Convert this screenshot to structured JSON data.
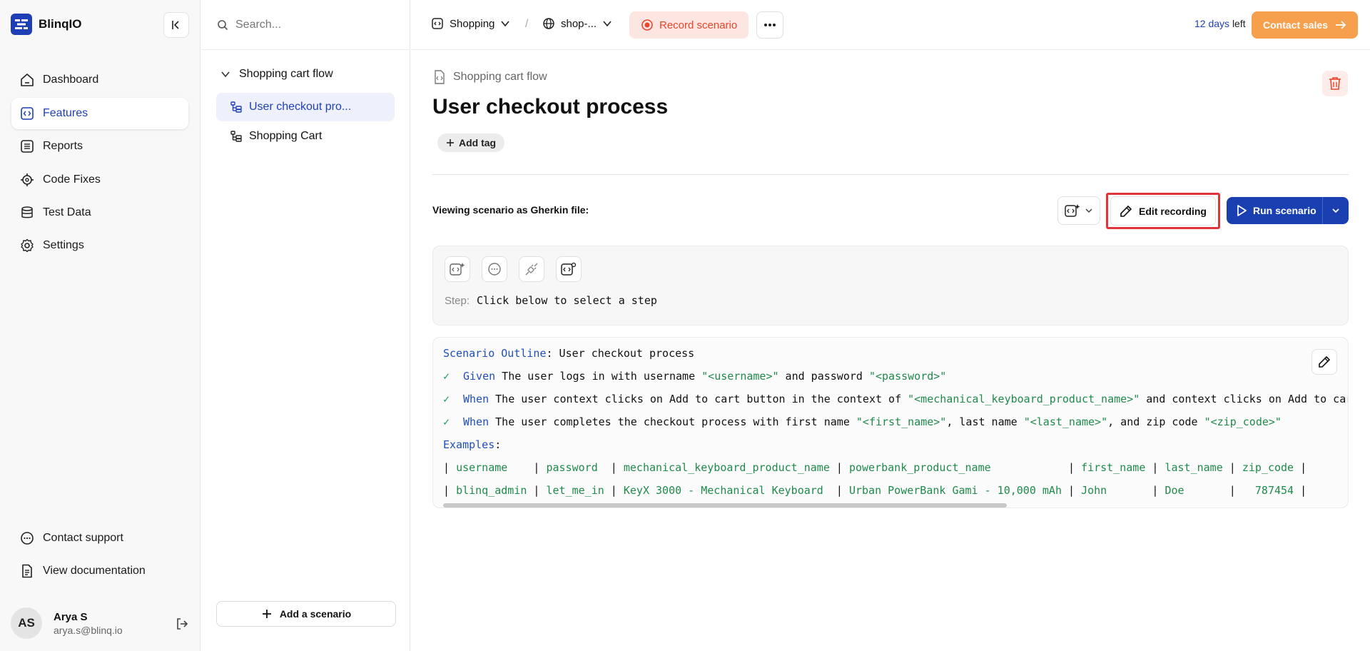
{
  "app": {
    "name": "BlinqIO",
    "colors": {
      "brand": "#1f3fb6",
      "accent": "#f6a04d",
      "record": "#e8452c",
      "success": "#1aa05a"
    }
  },
  "sidebar": {
    "nav": [
      {
        "label": "Dashboard",
        "icon": "home-icon"
      },
      {
        "label": "Features",
        "icon": "feature-file-icon",
        "active": true
      },
      {
        "label": "Reports",
        "icon": "report-list-icon"
      },
      {
        "label": "Code Fixes",
        "icon": "code-gear-icon"
      },
      {
        "label": "Test Data",
        "icon": "database-icon"
      },
      {
        "label": "Settings",
        "icon": "gear-icon"
      }
    ],
    "bottom": [
      {
        "label": "Contact support",
        "icon": "chat-bubble-icon"
      },
      {
        "label": "View documentation",
        "icon": "document-icon"
      }
    ],
    "user": {
      "initials": "AS",
      "name": "Arya S",
      "email": "arya.s@blinq.io"
    }
  },
  "tree": {
    "search_placeholder": "Search...",
    "feature": "Shopping cart flow",
    "items": [
      {
        "label": "User checkout pro...",
        "selected": true
      },
      {
        "label": "Shopping Cart",
        "selected": false
      }
    ],
    "add_scenario": "Add a scenario"
  },
  "topbar": {
    "project": "Shopping",
    "separator": "/",
    "environment": "shop-...",
    "record": "Record scenario",
    "trial_days": "12 days",
    "trial_suffix": "left",
    "contact_sales": "Contact sales"
  },
  "main": {
    "breadcrumb": "Shopping cart flow",
    "title": "User checkout process",
    "add_tag": "Add tag",
    "viewing_label": "Viewing scenario as Gherkin file:",
    "edit_recording": "Edit recording",
    "run_scenario": "Run scenario",
    "step_label": "Step:",
    "step_value": "Click below to select a step"
  },
  "gherkin": {
    "outline_kw": "Scenario Outline",
    "outline_name": ": User checkout process",
    "steps": [
      {
        "kw": "Given",
        "segments": [
          {
            "t": " The user logs in with username ",
            "c": ""
          },
          {
            "t": "\"<username>\"",
            "c": "str"
          },
          {
            "t": " and password ",
            "c": ""
          },
          {
            "t": "\"<password>\"",
            "c": "str"
          }
        ]
      },
      {
        "kw": "When",
        "segments": [
          {
            "t": " The user context clicks on Add to cart button in the context of ",
            "c": ""
          },
          {
            "t": "\"<mechanical_keyboard_product_name>\"",
            "c": "str"
          },
          {
            "t": " and context clicks on Add to car",
            "c": ""
          }
        ]
      },
      {
        "kw": "When",
        "segments": [
          {
            "t": " The user completes the checkout process with first name ",
            "c": ""
          },
          {
            "t": "\"<first_name>\"",
            "c": "str"
          },
          {
            "t": ", last name ",
            "c": ""
          },
          {
            "t": "\"<last_name>\"",
            "c": "str"
          },
          {
            "t": ", and zip code ",
            "c": ""
          },
          {
            "t": "\"<zip_code>\"",
            "c": "str"
          }
        ]
      }
    ],
    "examples_kw": "Examples",
    "table": {
      "header": [
        "username   ",
        "password ",
        "mechanical_keyboard_product_name",
        "powerbank_product_name           ",
        "first_name",
        "last_name",
        "zip_code"
      ],
      "row": [
        "blinq_admin",
        "let_me_in",
        "KeyX 3000 - Mechanical Keyboard ",
        "Urban PowerBank Gami - 10,000 mAh",
        "John      ",
        "Doe      ",
        "  787454"
      ]
    }
  }
}
